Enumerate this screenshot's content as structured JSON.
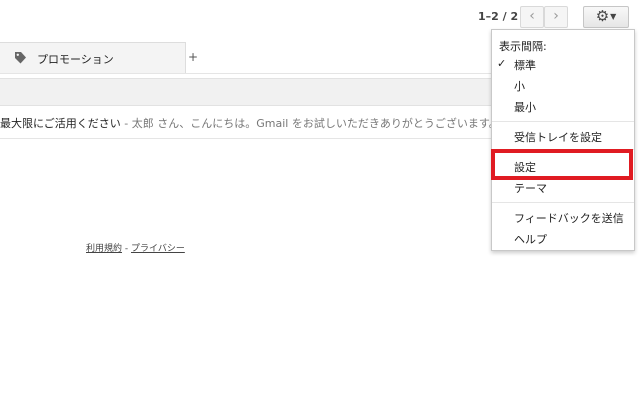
{
  "toolbar": {
    "pager_text": "1–2 / 2",
    "prev_icon": "chevron-left-icon",
    "next_icon": "chevron-right-icon",
    "settings_icon": "gear-icon"
  },
  "tabs": [
    {
      "label": "プロモーション",
      "icon": "tag-icon"
    }
  ],
  "add_tab_label": "+",
  "email": {
    "subject": "最大限にご活用ください",
    "snippet": " - 太郎 さん、こんにちは。Gmail をお試しいただきありがとうございます。快適にお使いいただ"
  },
  "footer": {
    "terms": "利用規約",
    "separator": " - ",
    "privacy": "プライバシー"
  },
  "settings_menu": {
    "density_heading": "表示間隔:",
    "density_options": [
      "標準",
      "小",
      "最小"
    ],
    "selected_density": "標準",
    "inbox_settings": "受信トレイを設定",
    "settings": "設定",
    "themes": "テーマ",
    "feedback": "フィードバックを送信",
    "help": "ヘルプ"
  },
  "colors": {
    "highlight": "#e01b22"
  }
}
